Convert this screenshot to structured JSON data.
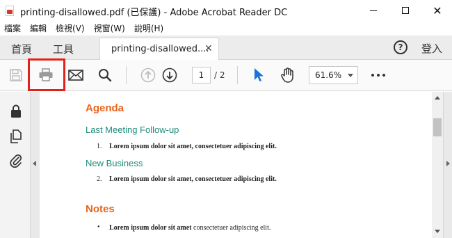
{
  "window": {
    "title": "printing-disallowed.pdf (已保護) - Adobe Acrobat Reader DC",
    "minimize_icon": "minimize-icon",
    "maximize_icon": "maximize-icon",
    "close_icon": "close-icon",
    "close_glyph": "✕"
  },
  "menu": [
    "檔案",
    "編輯",
    "檢視(V)",
    "視窗(W)",
    "說明(H)"
  ],
  "tabs": {
    "home": "首頁",
    "tools": "工具",
    "document": "printing-disallowed....",
    "close_glyph": "✕",
    "help_glyph": "?",
    "login": "登入"
  },
  "toolbar": {
    "save_icon": "save-icon",
    "print_icon": "print-icon",
    "mail_icon": "mail-icon",
    "search_icon": "search-icon",
    "prev_page_icon": "arrow-up-icon",
    "next_page_icon": "arrow-down-icon",
    "current_page": "1",
    "total_pages": "/ 2",
    "select_tool_icon": "cursor-icon",
    "hand_tool_icon": "hand-icon",
    "zoom": "61.6%",
    "more_icon": "more-icon",
    "print_highlight_color": "#e3201b"
  },
  "left_pane": {
    "icons": [
      "lock-icon",
      "pages-icon",
      "attachment-icon"
    ]
  },
  "document": {
    "agenda_heading": "Agenda",
    "sections": [
      {
        "heading": "Last Meeting Follow-up",
        "item_number": "1.",
        "item_text": "Lorem ipsum dolor sit amet, consectetuer adipiscing elit."
      },
      {
        "heading": "New Business",
        "item_number": "2.",
        "item_text": "Lorem ipsum dolor sit amet, consectetuer adipiscing elit."
      }
    ],
    "notes_heading": "Notes",
    "notes_bullet": "•",
    "notes_bold": "Lorem ipsum dolor sit amet",
    "notes_rest": " consectetuer adipiscing elit."
  },
  "colors": {
    "heading_orange": "#e8641c",
    "heading_teal": "#1f8a7a",
    "accent_blue": "#1a73d9"
  }
}
